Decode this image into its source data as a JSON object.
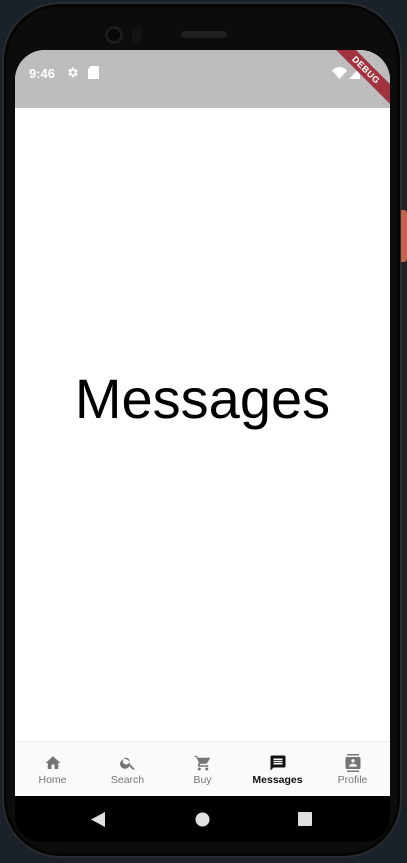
{
  "status_bar": {
    "time": "9:46",
    "debug_banner": "DEBUG",
    "background_color": "#bdbdbd"
  },
  "main": {
    "title": "Messages"
  },
  "bottom_nav": {
    "items": [
      {
        "label": "Home",
        "icon": "home-icon",
        "active": false
      },
      {
        "label": "Search",
        "icon": "search-icon",
        "active": false
      },
      {
        "label": "Buy",
        "icon": "cart-icon",
        "active": false
      },
      {
        "label": "Messages",
        "icon": "message-icon",
        "active": true
      },
      {
        "label": "Profile",
        "icon": "contact-icon",
        "active": false
      }
    ]
  },
  "system_nav": {
    "buttons": [
      "back-icon",
      "home-circle-icon",
      "recents-icon"
    ]
  }
}
